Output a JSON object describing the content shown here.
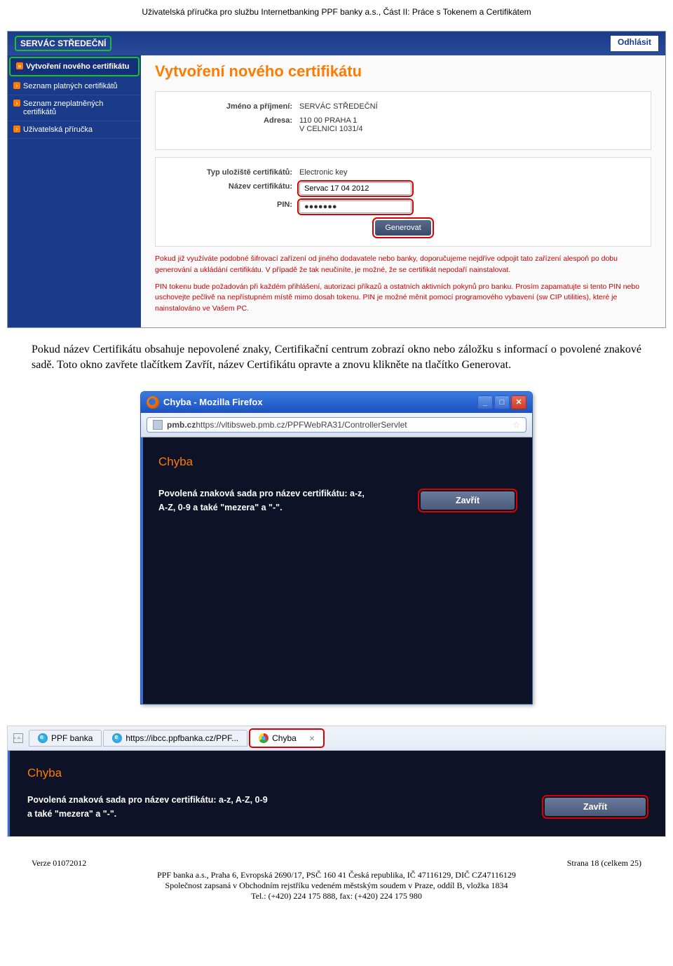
{
  "doc": {
    "header": "Uživatelská příručka pro službu Internetbanking PPF banky a.s., Část II: Práce s Tokenem a Certifikátem"
  },
  "app": {
    "user": "SERVÁC STŘEDEČNÍ",
    "logout": "Odhlásit",
    "sidebar": [
      {
        "label": "Vytvoření nového certifikátu",
        "active": true
      },
      {
        "label": "Seznam platných certifikátů",
        "active": false
      },
      {
        "label": "Seznam zneplatněných certifikátů",
        "active": false
      },
      {
        "label": "Uživatelská příručka",
        "active": false
      }
    ],
    "title": "Vytvoření nového certifikátu",
    "form": {
      "name_label": "Jméno a příjmení:",
      "name_value": "SERVÁC STŘEDEČNÍ",
      "addr_label": "Adresa:",
      "addr_value1": "110 00 PRAHA 1",
      "addr_value2": "V CELNICI 1031/4",
      "storage_label": "Typ uložiště certifikátů:",
      "storage_value": "Electronic key",
      "certname_label": "Název certifikátu:",
      "certname_value": "Servac 17 04 2012",
      "pin_label": "PIN:",
      "pin_value": "●●●●●●●",
      "generate": "Generovat"
    },
    "warnings": {
      "p1": "Pokud již využíváte podobné šifrovací zařízení od jiného dodavatele nebo banky, doporučujeme nejdříve odpojit tato zařízení alespoň po dobu generování a ukládání certifikátu. V případě že tak neučiníte, je možné, že se certifikát nepodaří nainstalovat.",
      "p2": "PIN tokenu bude požadován při každém přihlášení, autorizaci příkazů a ostatních aktivních pokynů pro banku. Prosím zapamatujte si tento PIN nebo uschovejte pečlivě na nepřístupném místě mimo dosah tokenu. PIN je možné měnit pomocí programového vybavení (sw CIP utilities), které je nainstalováno ve Vašem PC."
    }
  },
  "body_text": "Pokud název Certifikátu obsahuje nepovolené znaky, Certifikační centrum zobrazí okno nebo záložku s informací o povolené znakové sadě. Toto okno zavřete tlačítkem Zavřít, název Certifikátu opravte a znovu klikněte na tlačítko Generovat.",
  "firefox": {
    "title": "Chyba - Mozilla Firefox",
    "url_host": "pmb.cz",
    "url_path": " https://vltibsweb.pmb.cz/PPFWebRA31/ControllerServlet",
    "heading": "Chyba",
    "msg1": "Povolená znaková sada pro název certifikátu: a-z,",
    "msg2": "A-Z, 0-9 a také \"mezera\" a \"-\".",
    "close": "Zavřít"
  },
  "ie": {
    "tab1": "PPF banka",
    "tab2": "https://ibcc.ppfbanka.cz/PPF...",
    "tab3": "Chyba",
    "heading": "Chyba",
    "msg1": "Povolená znaková sada pro název certifikátu: a-z, A-Z, 0-9",
    "msg2": "a také \"mezera\" a \"-\".",
    "close": "Zavřít"
  },
  "footer": {
    "version": "Verze 01072012",
    "page": "Strana 18 (celkem 25)",
    "line1": "PPF banka a.s., Praha 6, Evropská 2690/17, PSČ 160 41 Česká republika, IČ 47116129, DIČ CZ47116129",
    "line2": "Společnost zapsaná v Obchodním rejstříku vedeném městským soudem v Praze, oddíl B, vložka 1834",
    "line3": "Tel.: (+420) 224 175 888, fax: (+420) 224 175 980"
  }
}
